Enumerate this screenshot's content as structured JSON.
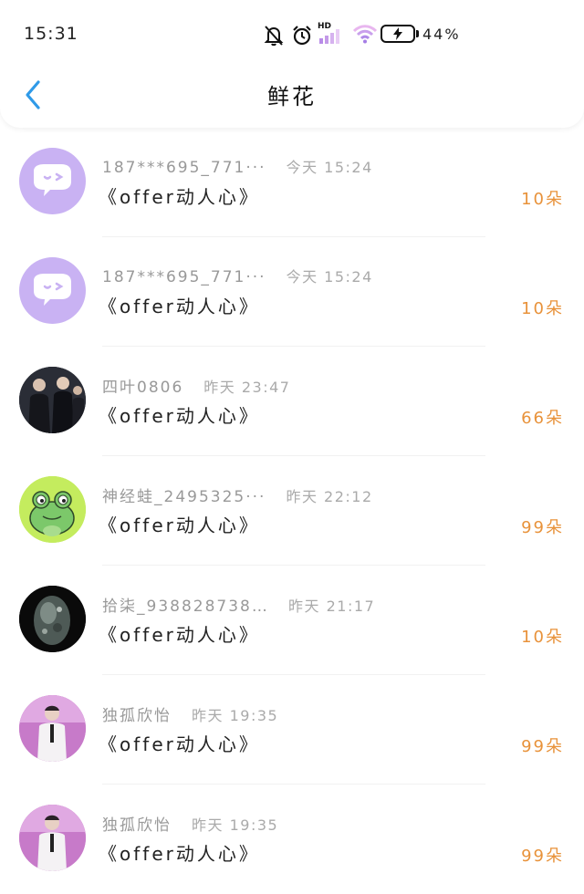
{
  "status_bar": {
    "time": "15:31",
    "network_badge": "HD",
    "battery_percent": "44%"
  },
  "nav": {
    "title": "鲜花"
  },
  "items": [
    {
      "name": "187***695_771···",
      "time": "今天 15:24",
      "program": "《offer动人心》",
      "amount": "10朵",
      "avatar": "default-chat-bubble"
    },
    {
      "name": "187***695_771···",
      "time": "今天 15:24",
      "program": "《offer动人心》",
      "amount": "10朵",
      "avatar": "default-chat-bubble"
    },
    {
      "name": "四叶0806",
      "time": "昨天 23:47",
      "program": "《offer动人心》",
      "amount": "66朵",
      "avatar": "group-photo"
    },
    {
      "name": "神经蛙_2495325···",
      "time": "昨天 22:12",
      "program": "《offer动人心》",
      "amount": "99朵",
      "avatar": "frog"
    },
    {
      "name": "拾柒_938828738···",
      "time": "昨天 21:17",
      "program": "《offer动人心》",
      "amount": "10朵",
      "avatar": "crystal"
    },
    {
      "name": "独孤欣怡",
      "time": "昨天 19:35",
      "program": "《offer动人心》",
      "amount": "99朵",
      "avatar": "stage-person"
    },
    {
      "name": "独孤欣怡",
      "time": "昨天 19:35",
      "program": "《offer动人心》",
      "amount": "99朵",
      "avatar": "stage-person"
    }
  ],
  "colors": {
    "accent_back": "#2f9ae8",
    "amount": "#e8923a",
    "default_avatar_bg": "#c9b2f3"
  }
}
